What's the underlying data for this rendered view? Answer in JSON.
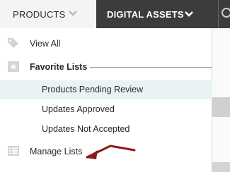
{
  "nav": {
    "products_label": "PRODUCTS",
    "digital_assets_label": "DIGITAL ASSETS",
    "products_chevron_icon": "chevron-down-icon",
    "digital_chevron_icon": "chevron-down-icon",
    "search_icon": "search-icon"
  },
  "menu": {
    "view_all": "View All",
    "favorite_lists_heading": "Favorite Lists",
    "favorites": [
      "Products Pending Review",
      "Updates Approved",
      "Updates Not Accepted"
    ],
    "manage_lists": "Manage Lists",
    "icons": {
      "view_all": "tag-icon",
      "favorite_lists": "star-icon",
      "manage_lists": "list-icon"
    }
  },
  "colors": {
    "active_tab": "#3c3c3c",
    "highlight_row": "#e9f3f3",
    "annotation_arrow": "#8b1a1a"
  }
}
